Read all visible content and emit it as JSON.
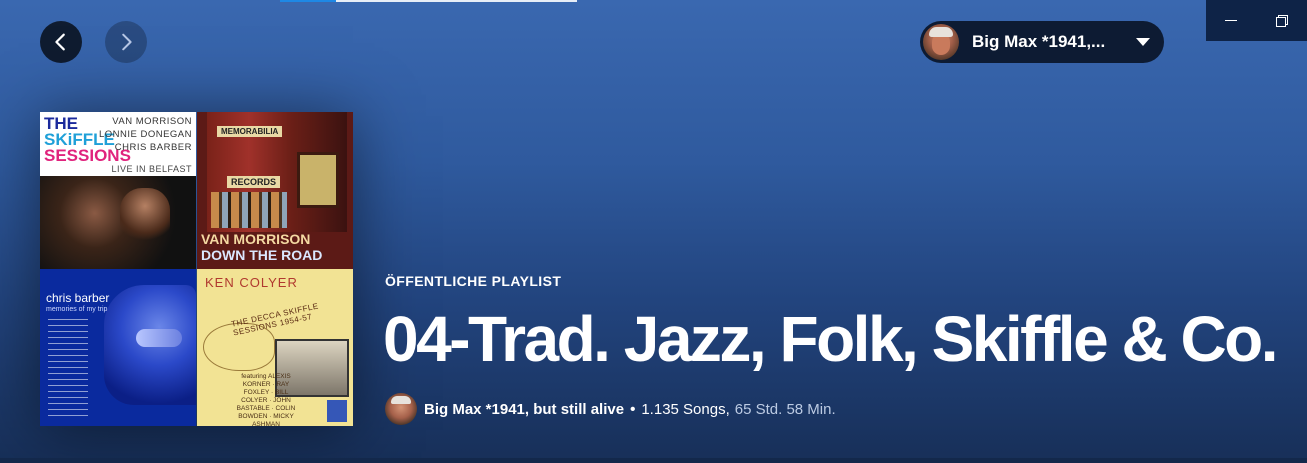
{
  "nav": {
    "back_icon": "chevron-left-icon",
    "forward_icon": "chevron-right-icon"
  },
  "user": {
    "name": "Big Max *1941,...",
    "dropdown_icon": "caret-down-icon"
  },
  "window_controls": {
    "minimize_icon": "minimize-icon",
    "restore_icon": "restore-icon"
  },
  "cover_art": {
    "tile1": {
      "line1": "THE",
      "line2": "SKiFFLE",
      "line3": "SESSIONS",
      "artists": [
        "VAN MORRISON",
        "LONNIE DONEGAN",
        "CHRIS BARBER"
      ],
      "subtitle": "LIVE IN BELFAST"
    },
    "tile2": {
      "sign1": "MEMORABILIA",
      "sign2": "RECORDS",
      "artist": "VAN MORRISON",
      "album": "DOWN THE ROAD"
    },
    "tile3": {
      "artist": "chris barber",
      "subtitle": "memories of my trip"
    },
    "tile4": {
      "artist": "KEN COLYER",
      "album": "THE DECCA SKIFFLE SESSIONS 1954-57",
      "featuring": "featuring ALEXIS KORNER · RAY FOXLEY · BILL COLYER · JOHN BASTABLE · COLIN BOWDEN · MICKY ASHMAN"
    }
  },
  "playlist": {
    "type_label": "ÖFFENTLICHE PLAYLIST",
    "title": "04-Trad. Jazz, Folk, Skiffle & Co.",
    "owner": "Big Max *1941, but still alive",
    "separator": "•",
    "song_count": "1.135 Songs,",
    "duration": "65 Std. 58 Min."
  },
  "colors": {
    "background_top": "#3a68b0",
    "background_bottom": "#172f58",
    "user_pill": "#0d1b33"
  }
}
